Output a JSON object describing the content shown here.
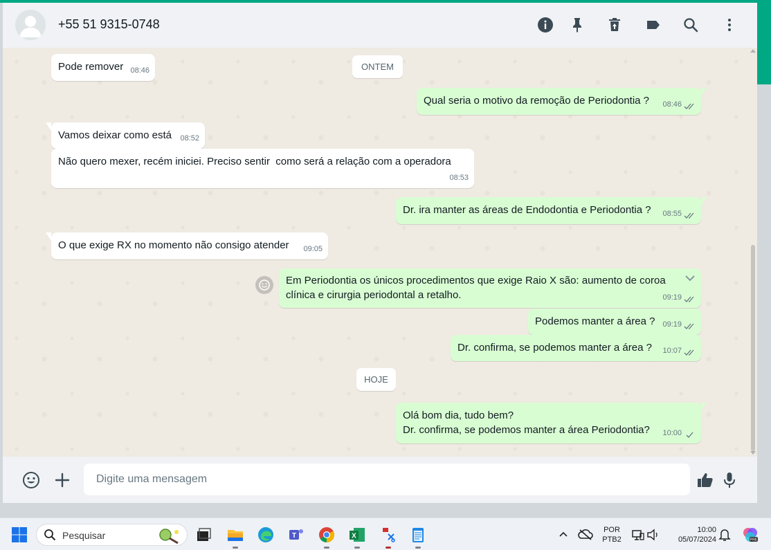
{
  "header": {
    "contact_name": "+55 51 9315-0748"
  },
  "messages": [
    {
      "direction": "in",
      "text": "Pode remover",
      "time": "08:46"
    },
    {
      "direction": "out",
      "text": "Qual seria o motivo da remoção de Periodontia ?",
      "time": "08:46",
      "status": "read"
    },
    {
      "direction": "in",
      "text": "Vamos deixar como está",
      "time": "08:52"
    },
    {
      "direction": "in",
      "text": "Não quero mexer, recém iniciei. Preciso sentir  como será a relação com a operadora",
      "time": "08:53"
    },
    {
      "direction": "out",
      "text": "Dr. ira manter as áreas de Endodontia e Periodontia ?",
      "time": "08:55",
      "status": "read"
    },
    {
      "direction": "in",
      "text": "O que exige RX no momento não consigo atender",
      "time": "09:05"
    },
    {
      "direction": "out",
      "text_line1": "Em Periodontia os únicos procedimentos que exige Raio X são: aumento de coroa",
      "text_line2": "clínica e cirurgia periodontal a retalho.",
      "time": "09:19",
      "status": "read"
    },
    {
      "direction": "out",
      "text": "Podemos manter a área ?",
      "time": "09:19",
      "status": "read"
    },
    {
      "direction": "out",
      "text": "Dr. confirma, se podemos manter a área ?",
      "time": "10:07",
      "status": "read"
    },
    {
      "direction": "out",
      "text_line1": "Olá bom dia, tudo bem?",
      "text_line2": "Dr. confirma, se podemos manter a área Periodontia?",
      "time": "10:00",
      "status": "delivered"
    }
  ],
  "date_chips": {
    "yesterday": "ONTEM",
    "today": "HOJE"
  },
  "footer": {
    "placeholder": "Digite uma mensagem"
  },
  "taskbar": {
    "search_label": "Pesquisar",
    "lang_line1": "POR",
    "lang_line2": "PTB2",
    "clock_time": "10:00",
    "clock_date": "05/07/2024"
  },
  "colors": {
    "accent": "#00a884",
    "outgoing_bubble": "#d9fdd3",
    "incoming_bubble": "#ffffff",
    "chat_bg": "#efeae2",
    "read_ticks": "#667781"
  },
  "icons": {
    "header": [
      "info-icon",
      "pin-icon",
      "delete-icon",
      "label-icon",
      "search-icon",
      "menu-icon"
    ],
    "footer": [
      "emoji-icon",
      "attach-plus-icon",
      "thumbs-up-icon",
      "microphone-icon"
    ]
  }
}
